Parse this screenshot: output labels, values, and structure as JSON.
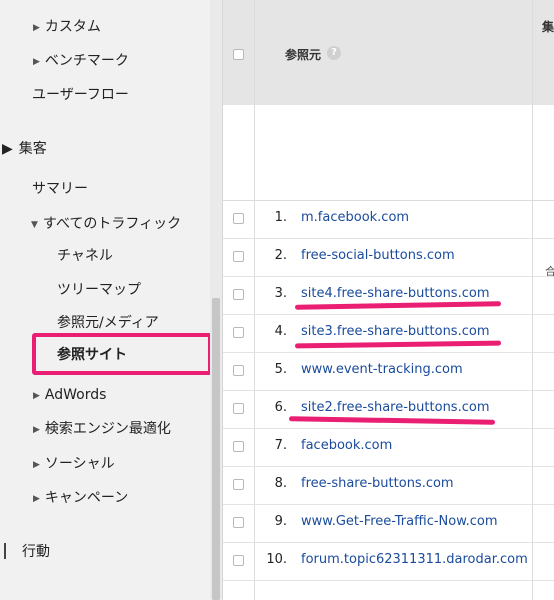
{
  "sidebar": {
    "items": [
      {
        "label": "カスタム"
      },
      {
        "label": "ベンチマーク"
      },
      {
        "label": "ユーザーフロー"
      },
      {
        "label": "集客"
      },
      {
        "label": "サマリー"
      },
      {
        "label": "すべてのトラフィック"
      },
      {
        "label": "チャネル"
      },
      {
        "label": "ツリーマップ"
      },
      {
        "label": "参照元/メディア"
      },
      {
        "label": "参照サイト"
      },
      {
        "label": "AdWords"
      },
      {
        "label": "検索エンジン最適化"
      },
      {
        "label": "ソーシャル"
      },
      {
        "label": "キャンペーン"
      },
      {
        "label": "行動"
      }
    ],
    "active_item": "参照サイト"
  },
  "table": {
    "header": {
      "source_label": "参照元",
      "help_symbol": "?",
      "next_column_label_partial": "集",
      "subheader_partial": "合"
    },
    "rows": [
      {
        "rank": "1.",
        "source": "m.facebook.com"
      },
      {
        "rank": "2.",
        "source": "free-social-buttons.com"
      },
      {
        "rank": "3.",
        "source": "site4.free-share-buttons.com"
      },
      {
        "rank": "4.",
        "source": "site3.free-share-buttons.com"
      },
      {
        "rank": "5.",
        "source": "www.event-tracking.com"
      },
      {
        "rank": "6.",
        "source": "site2.free-share-buttons.com"
      },
      {
        "rank": "7.",
        "source": "facebook.com"
      },
      {
        "rank": "8.",
        "source": "free-share-buttons.com"
      },
      {
        "rank": "9.",
        "source": "www.Get-Free-Traffic-Now.com"
      },
      {
        "rank": "10.",
        "source": "forum.topic62311311.darodar.com"
      }
    ]
  },
  "colors": {
    "highlight": "#ea1e73",
    "link": "#1a4b9c",
    "sidebar_bg": "#f1f1f1",
    "header_bg": "#e5e5e5"
  }
}
